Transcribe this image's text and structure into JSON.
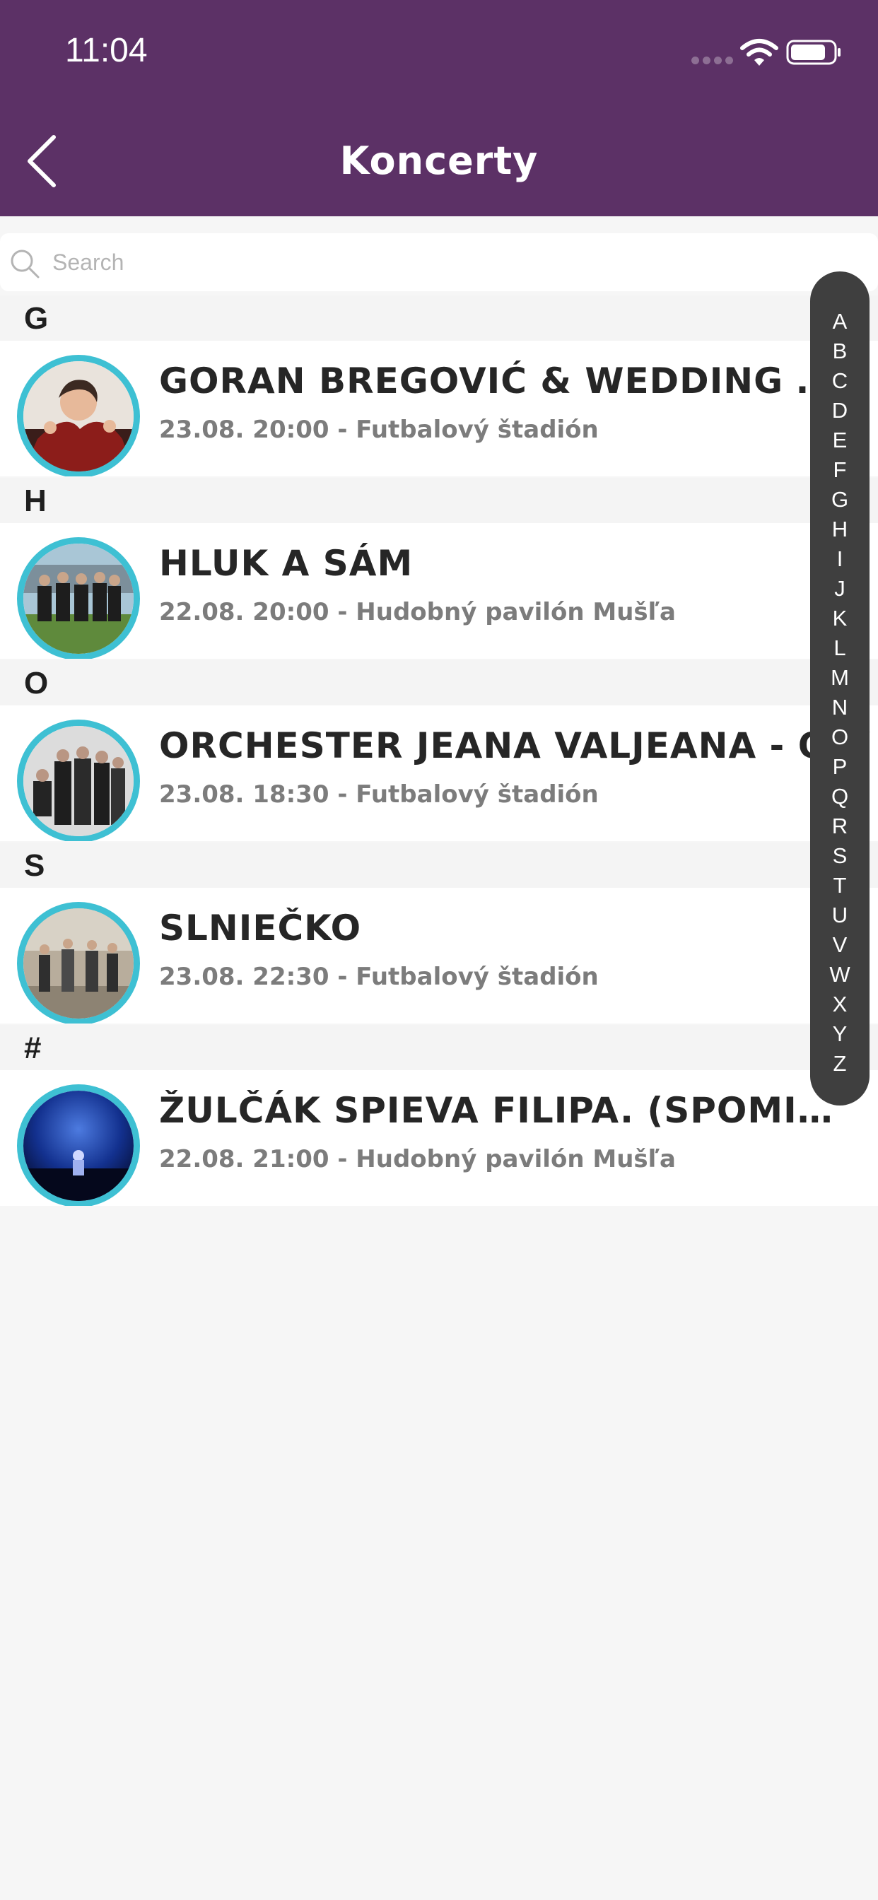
{
  "status_bar": {
    "time": "11:04"
  },
  "nav": {
    "title": "Koncerty"
  },
  "search": {
    "placeholder": "Search"
  },
  "sections": [
    {
      "letter": "G",
      "title": "GORAN BREGOVIĆ & WEDDING AND FUNERAL BAND",
      "subtitle": "23.08. 20:00 - Futbalový štadión"
    },
    {
      "letter": "H",
      "title": "HLUK A SÁM",
      "subtitle": "22.08. 20:00 - Hudobný pavilón Mušľa"
    },
    {
      "letter": "O",
      "title": "ORCHESTER JEANA VALJEANA - OJV",
      "subtitle": "23.08. 18:30 - Futbalový štadión"
    },
    {
      "letter": "S",
      "title": "SLNIEČKO",
      "subtitle": "23.08. 22:30 - Futbalový štadión"
    },
    {
      "letter": "#",
      "title": "ŽULČÁK SPIEVA FILIPA. (SPOMIENKA NA FILIPA)",
      "subtitle": "22.08. 21:00 - Hudobný pavilón Mušľa"
    }
  ],
  "index": [
    "A",
    "B",
    "C",
    "D",
    "E",
    "F",
    "G",
    "H",
    "I",
    "J",
    "K",
    "L",
    "M",
    "N",
    "O",
    "P",
    "Q",
    "R",
    "S",
    "T",
    "U",
    "V",
    "W",
    "X",
    "Y",
    "Z"
  ],
  "colors": {
    "header": "#5c3166",
    "avatar_ring": "#3ec0d3",
    "index_bar": "#3f3f3f"
  }
}
